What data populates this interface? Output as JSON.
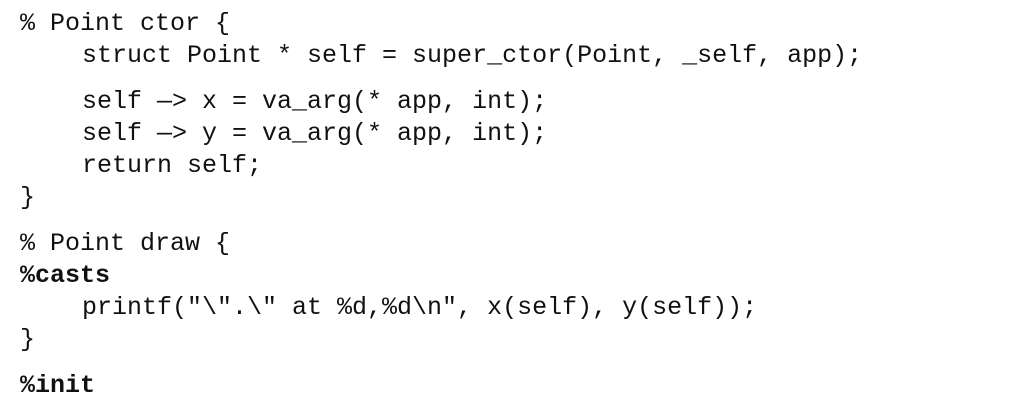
{
  "code": {
    "ctor_header": "% Point ctor {",
    "ctor_super": "struct Point * self = super_ctor(Point, _self, app);",
    "ctor_x": "self —> x = va_arg(* app, int);",
    "ctor_y": "self —> y = va_arg(* app, int);",
    "ctor_return": "return self;",
    "ctor_close": "}",
    "draw_header": "% Point draw {",
    "casts_directive": "%casts",
    "draw_printf": "printf(\"\\\".\\\" at %d,%d\\n\", x(self), y(self));",
    "draw_close": "}",
    "init_directive": "%init"
  }
}
